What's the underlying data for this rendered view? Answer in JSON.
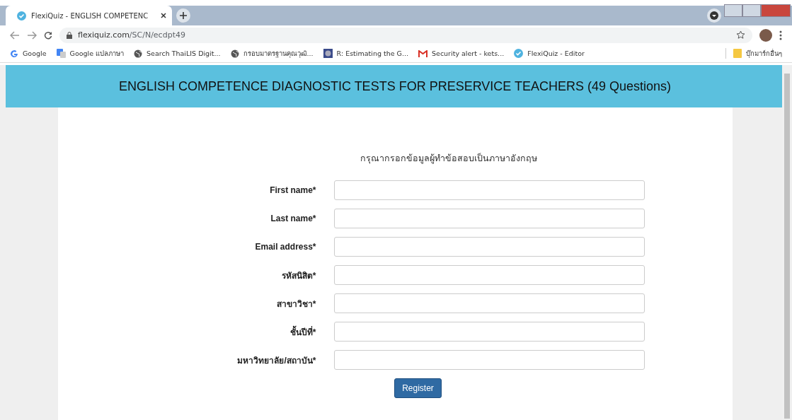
{
  "browser": {
    "tab": {
      "title": "FlexiQuiz - ENGLISH COMPETENC",
      "selected": true
    },
    "url": {
      "host": "flexiquiz.com",
      "path": "/SC/N/ecdpt49"
    },
    "bookmarks": [
      {
        "label": "Google",
        "kind": "google"
      },
      {
        "label": "Google แปลภาษา",
        "kind": "translate"
      },
      {
        "label": "Search ThaiLIS Digit...",
        "kind": "globe"
      },
      {
        "label": "กรอบมาตรฐานคุณวุฒิ...",
        "kind": "globe"
      },
      {
        "label": "R: Estimating the G...",
        "kind": "seal"
      },
      {
        "label": "Security alert - kets...",
        "kind": "mail"
      },
      {
        "label": "FlexiQuiz - Editor",
        "kind": "check"
      }
    ],
    "other_bookmarks": "บุ๊กมาร์กอื่นๆ"
  },
  "page": {
    "title": "ENGLISH COMPETENCE DIAGNOSTIC TESTS FOR PRESERVICE TEACHERS (49 Questions)",
    "instruction": "กรุณากรอกข้อมูลผู้ทำข้อสอบเป็นภาษาอังกฤษ",
    "fields": [
      {
        "label": "First name*"
      },
      {
        "label": "Last name*"
      },
      {
        "label": "Email address*"
      },
      {
        "label": "รหัสนิสิต*"
      },
      {
        "label": "สาขาวิชา*"
      },
      {
        "label": "ชั้นปีที่*"
      },
      {
        "label": "มหาวิทยาลัย/สถาบัน*"
      }
    ],
    "submit": "Register"
  }
}
